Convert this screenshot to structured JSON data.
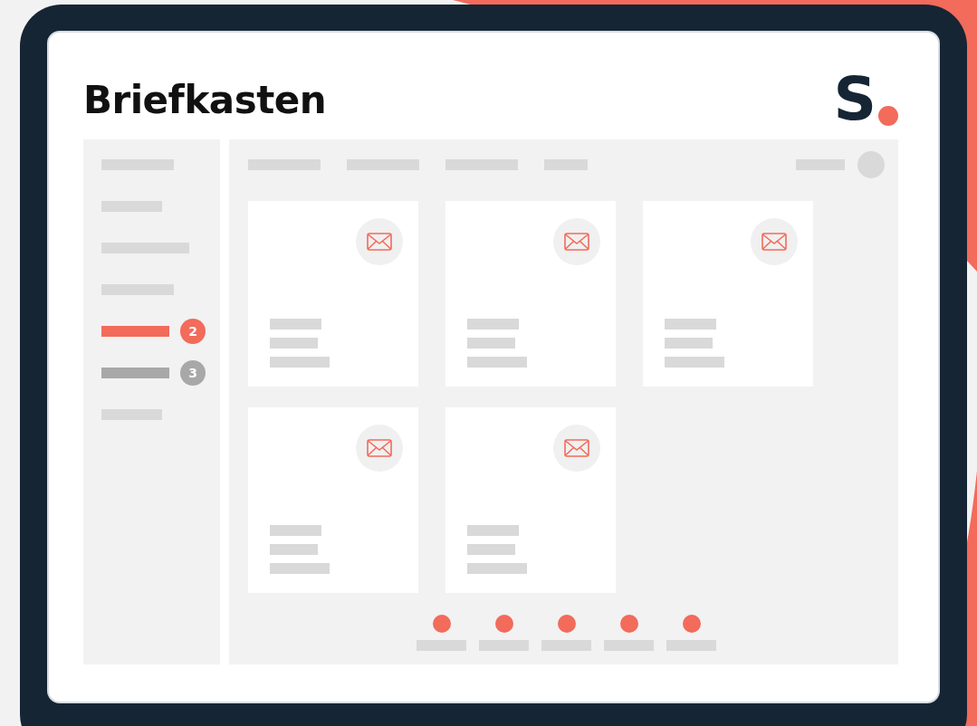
{
  "header": {
    "title": "Briefkasten",
    "logo": {
      "letter": "S"
    }
  },
  "sidebar": {
    "items": [
      {
        "selected": false
      },
      {
        "selected": false
      },
      {
        "selected": false
      },
      {
        "selected": false
      },
      {
        "selected": true,
        "badge": "2"
      },
      {
        "selected": false,
        "badge": "3"
      },
      {
        "selected": false
      }
    ]
  },
  "cards": [
    {
      "kind": "mail"
    },
    {
      "kind": "mail"
    },
    {
      "kind": "mail"
    },
    {
      "kind": "mail"
    },
    {
      "kind": "mail"
    }
  ],
  "pager": [
    {
      "kind": "dot"
    },
    {
      "kind": "dot"
    },
    {
      "kind": "dot"
    },
    {
      "kind": "dot"
    },
    {
      "kind": "dot"
    }
  ]
}
